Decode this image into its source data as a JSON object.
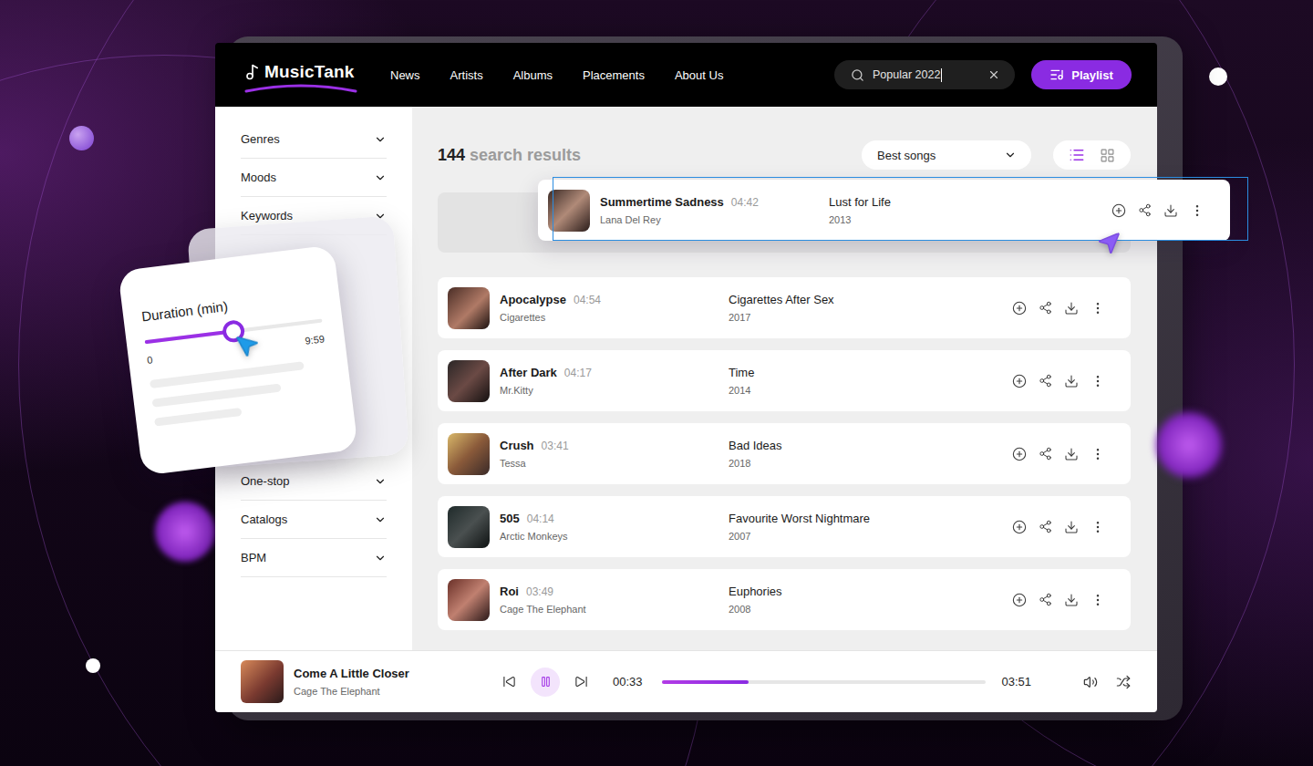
{
  "header": {
    "logo": "MusicTank",
    "nav": [
      {
        "label": "News"
      },
      {
        "label": "Artists"
      },
      {
        "label": "Albums"
      },
      {
        "label": "Placements"
      },
      {
        "label": "About Us"
      }
    ],
    "search": {
      "value": "Popular 2022"
    },
    "playlist_button": "Playlist"
  },
  "filters": {
    "top": [
      {
        "label": "Genres"
      },
      {
        "label": "Moods"
      },
      {
        "label": "Keywords"
      }
    ],
    "bottom": [
      {
        "label": "One-stop"
      },
      {
        "label": "Catalogs"
      },
      {
        "label": "BPM"
      }
    ]
  },
  "duration_filter": {
    "title": "Duration (min)",
    "min": "0",
    "max": "9:59",
    "level": 0.5
  },
  "results": {
    "count": "144",
    "label": "search results",
    "sort": "Best songs",
    "views": [
      {
        "kind": "list",
        "selected": true
      },
      {
        "kind": "grid",
        "selected": false
      }
    ]
  },
  "dragged_track": {
    "title": "Summertime Sadness",
    "duration": "04:42",
    "artist": "Lana Del Rey",
    "album": "Lust for Life",
    "year": "2013",
    "selected": true
  },
  "tracks": [
    {
      "title": "Apocalypse",
      "duration": "04:54",
      "artist": "Cigarettes",
      "album": "Cigarettes After Sex",
      "year": "2017"
    },
    {
      "title": "After Dark",
      "duration": "04:17",
      "artist": "Mr.Kitty",
      "album": "Time",
      "year": "2014"
    },
    {
      "title": "Crush",
      "duration": "03:41",
      "artist": "Tessa",
      "album": "Bad Ideas",
      "year": "2018"
    },
    {
      "title": "505",
      "duration": "04:14",
      "artist": "Arctic Monkeys",
      "album": "Favourite Worst Nightmare",
      "year": "2007"
    },
    {
      "title": "Roi",
      "duration": "03:49",
      "artist": "Cage The Elephant",
      "album": "Euphories",
      "year": "2008"
    }
  ],
  "player": {
    "title": "Come A Little Closer",
    "artist": "Cage The Elephant",
    "elapsed": "00:33",
    "total": "03:51",
    "level": 0.27,
    "playing": true
  }
}
